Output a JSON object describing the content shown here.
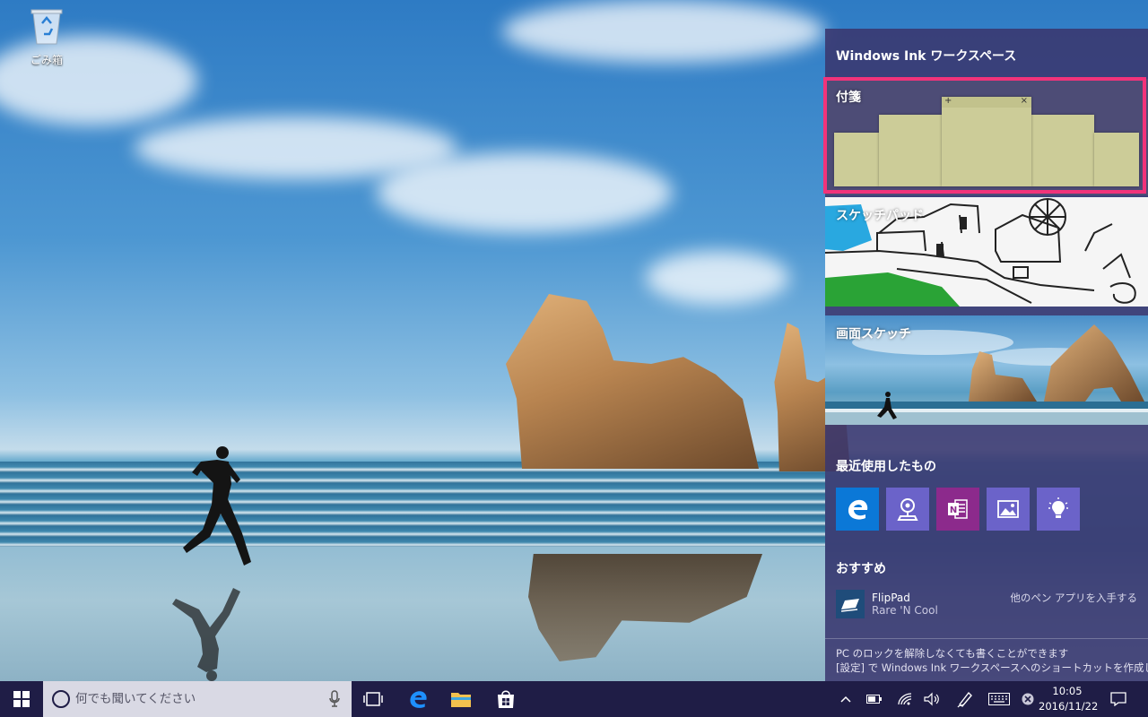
{
  "desktop": {
    "recycle_bin_label": "ごみ箱"
  },
  "ink_panel": {
    "title": "Windows Ink ワークスペース",
    "sticky_notes_label": "付箋",
    "sketchpad_label": "スケッチパッド",
    "screen_sketch_label": "画面スケッチ",
    "recent_title": "最近使用したもの",
    "recent_apps": [
      "edge-icon",
      "maps-icon",
      "onenote-icon",
      "photos-icon",
      "tips-icon"
    ],
    "recommended_title": "おすすめ",
    "recommended_app": {
      "name": "FlipPad",
      "developer": "Rare 'N Cool"
    },
    "get_more_link": "他のペン アプリを入手する",
    "footer_line1": "PC のロックを解除しなくても書くことができます",
    "footer_line2": "[設定] で Windows Ink ワークスペースへのショートカットを作成します",
    "highlight_color": "#f2337a"
  },
  "taskbar": {
    "search_placeholder": "何でも聞いてください",
    "clock_time": "10:05",
    "clock_date": "2016/11/22",
    "colors": {
      "taskbar": "#1f1d46",
      "accent": "#0078d7"
    }
  }
}
